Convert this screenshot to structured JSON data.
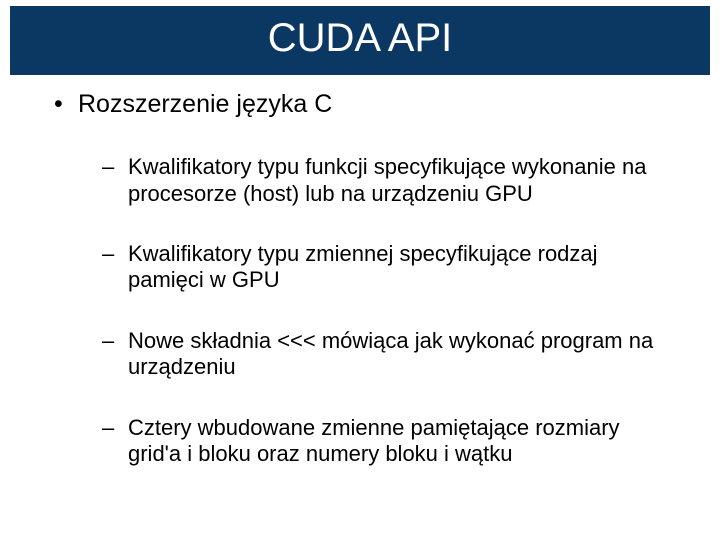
{
  "title": "CUDA API",
  "bullets": {
    "main": "Rozszerzenie języka C",
    "subs": [
      "Kwalifikatory typu funkcji specyfikujące wykonanie na procesorze (host) lub na urządzeniu GPU",
      "Kwalifikatory typu zmiennej specyfikujące rodzaj pamięci w GPU",
      "Nowe składnia <<< mówiąca jak wykonać program na urządzeniu",
      "Cztery wbudowane zmienne pamiętające rozmiary grid'a i bloku oraz numery bloku i wątku"
    ]
  }
}
